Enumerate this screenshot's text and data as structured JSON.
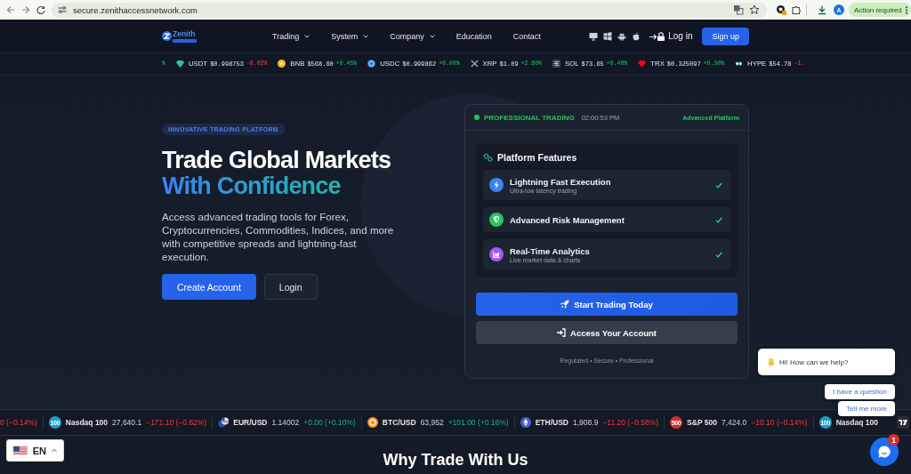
{
  "browser": {
    "url": "secure.zenithaccessnetwork.com",
    "avatar": "A",
    "action": "Action required"
  },
  "nav": {
    "brand": "Zenith",
    "links": [
      {
        "label": "Trading",
        "has_menu": true
      },
      {
        "label": "System",
        "has_menu": true
      },
      {
        "label": "Company",
        "has_menu": true
      },
      {
        "label": "Education",
        "has_menu": false
      },
      {
        "label": "Contact",
        "has_menu": false
      }
    ],
    "login": "Log in",
    "signup": "Sign up"
  },
  "crypto_ticker": [
    {
      "kind": "fragment",
      "change": "%",
      "rising": true
    },
    {
      "kind": "gem",
      "color": "#26c6a4",
      "symbol": "USDT",
      "price": "$0.998753",
      "change": "-0.02%",
      "rising": false
    },
    {
      "kind": "coin",
      "color": "#f3ba2f",
      "symbol": "BNB",
      "price": "$568.60",
      "change": "+0.45%",
      "rising": true
    },
    {
      "kind": "ring",
      "color": "#2775ca",
      "symbol": "USDC",
      "price": "$0.999862",
      "change": "+0.00%",
      "rising": true
    },
    {
      "kind": "cross",
      "color": "#9ca3af",
      "symbol": "XRP",
      "price": "$1.09",
      "change": "+2.60%",
      "rising": true
    },
    {
      "kind": "bars",
      "color": "#3a4357",
      "symbol": "SOL",
      "price": "$73.65",
      "change": "+0.40%",
      "rising": true
    },
    {
      "kind": "gem",
      "color": "#ef0027",
      "symbol": "TRX",
      "price": "$0.325097",
      "change": "+0.30%",
      "rising": true
    },
    {
      "kind": "loop",
      "color": "#97fce4",
      "symbol": "HYPE",
      "price": "$54.78",
      "change": "-1.",
      "rising": false
    }
  ],
  "hero": {
    "badge": "INNOVATIVE TRADING PLATFORM",
    "title": "Trade Global Markets",
    "highlight": "With Confidence",
    "text": "Access advanced trading tools for Forex, Cryptocurrencies, Commodities, Indices, and more with competitive spreads and lightning-fast execution.",
    "buttons": [
      {
        "label": "Create Account",
        "kind": "primary"
      },
      {
        "label": "Login",
        "kind": "secondary"
      }
    ]
  },
  "panel": {
    "status": "PROFESSIONAL TRADING",
    "time": "02:00:53 PM",
    "tag": "Advanced Platform",
    "features_title": "Platform Features",
    "features": [
      {
        "kind": "bolt",
        "color": "#3b82f6",
        "title": "Lightning Fast Execution",
        "subtitle": "Ultra-low latency trading",
        "checked": true
      },
      {
        "kind": "shield",
        "color": "#22c55e",
        "title": "Advanced Risk Management",
        "checked": true
      },
      {
        "kind": "chart",
        "color": "#a855f7",
        "title": "Real-Time Analytics",
        "subtitle": "Live market data & charts",
        "checked": true
      }
    ],
    "actions": [
      {
        "label": "Start Trading Today",
        "kind": "primary"
      },
      {
        "label": "Access Your Account",
        "kind": "secondary"
      }
    ],
    "footer": "Regulated • Secure • Professional"
  },
  "market_ticker": [
    {
      "kind": "fragment",
      "change": "0 (−0.14%)",
      "rising": false
    },
    {
      "kind": "index",
      "badge": "100",
      "color": "#1c9fc4",
      "symbol": "Nasdaq 100",
      "price": "27,640.1",
      "change": "−171.10 (−0.62%)",
      "rising": false
    },
    {
      "kind": "pair",
      "symbol": "EUR/USD",
      "price": "1.14002",
      "change": "+0.00 (+0.10%)",
      "rising": true
    },
    {
      "kind": "coin",
      "symbol": "BTC/USD",
      "price": "63,952",
      "change": "+101.00 (+0.16%)",
      "rising": true
    },
    {
      "kind": "ether",
      "symbol": "ETH/USD",
      "price": "1,908.9",
      "change": "−11.20 (−0.58%)",
      "rising": false
    },
    {
      "kind": "index",
      "badge": "500",
      "color": "#d32f2f",
      "symbol": "S&P 500",
      "price": "7,424.0",
      "change": "−10.10 (−0.14%)",
      "rising": false
    },
    {
      "kind": "index",
      "badge": "100",
      "color": "#1c9fc4",
      "symbol": "Nasdaq 100"
    }
  ],
  "section_title": "Why Trade With Us",
  "language": {
    "code": "EN"
  },
  "chat": {
    "greeting": "Hi! How can we help?",
    "replies": [
      "I have a question",
      "Tell me more"
    ],
    "badge": "1"
  }
}
